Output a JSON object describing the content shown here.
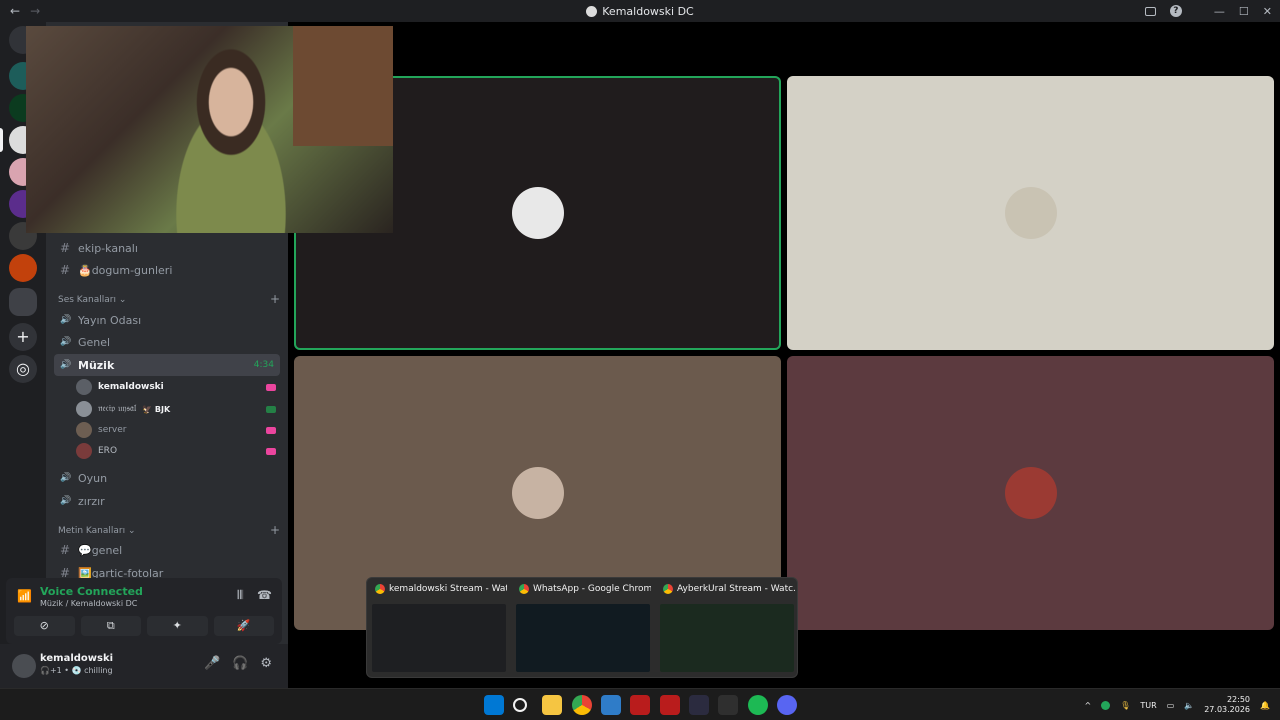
{
  "window": {
    "title": "Kemaldowski DC",
    "back_glyph": "←",
    "forward_glyph": "→"
  },
  "titlebar_icons": [
    "inbox-icon",
    "help-icon",
    "minimize-icon",
    "maximize-icon",
    "close-icon"
  ],
  "titlebar_glyphs": {
    "help": "?",
    "minimize": "—",
    "maximize": "☐",
    "close": "✕"
  },
  "sidebar": {
    "text_channels_top": [
      {
        "name": "ekip-kanalı",
        "symbol": "#"
      },
      {
        "name": "🎂dogum-gunleri",
        "symbol": "#"
      }
    ],
    "voice_category": {
      "label": "Ses Kanalları ⌄",
      "add": "+"
    },
    "voice_channels": [
      {
        "name": "Yayın Odası",
        "symbol": "🔊"
      },
      {
        "name": "Genel",
        "symbol": "🔊"
      },
      {
        "name": "Müzik",
        "symbol": "🔊",
        "time": "4:34",
        "active": true
      }
    ],
    "voice_users": [
      {
        "name": "kemaldowski",
        "avatar_color": "#5b5f66",
        "status_color": "#eb459e"
      },
      {
        "name": "𝔫𝔢𝔠𝔦𝔭 𝔲𝔶𝔰𝔞𝔩",
        "badge": "🦅 BJK",
        "avatar_color": "#8a8f96",
        "status_color": "#248046"
      },
      {
        "name": "server",
        "avatar_color": "#6d5e52",
        "status_color": "#eb459e"
      },
      {
        "name": "ERO",
        "avatar_color": "#7a3b3b",
        "status_color": "#eb459e"
      }
    ],
    "voice_channels_after": [
      {
        "name": "Oyun",
        "symbol": "🔊"
      },
      {
        "name": "zırzır",
        "symbol": "🔊"
      }
    ],
    "text_category": {
      "label": "Metin Kanalları ⌄",
      "add": "+"
    },
    "text_channels_bottom": [
      {
        "name": "💬genel",
        "symbol": "#"
      },
      {
        "name": "🖼️gartic-fotolar",
        "symbol": "#"
      }
    ]
  },
  "voice_panel": {
    "title": "Voice Connected",
    "subtitle": "Müzik / Kemaldowski DC",
    "signal_glyph": "📶",
    "right_glyphs": [
      "𝄃𝄃",
      "☎"
    ],
    "buttons": [
      "⊘",
      "⧉",
      "✦",
      "🚀"
    ]
  },
  "user": {
    "name": "kemaldowski",
    "status": "🎧+1 • 💿 chilling",
    "controls": [
      "🎤",
      "🎧",
      "⚙"
    ]
  },
  "stage": {
    "tiles": [
      {
        "bg": "#201c1d",
        "avatar": "#e8e8e8",
        "speaking": true
      },
      {
        "bg": "#d4d1c6",
        "avatar": "#c9c3b3",
        "speaking": false
      },
      {
        "bg": "#6b5a4d",
        "avatar": "#c7b3a3",
        "speaking": false
      },
      {
        "bg": "#5c3a3f",
        "avatar": "#9b3a33",
        "speaking": false
      }
    ]
  },
  "thumbnails": [
    {
      "title": "kemaldowski Stream - Wat..."
    },
    {
      "title": "WhatsApp - Google Chrome"
    },
    {
      "title": "AyberkUral Stream - Watc..."
    }
  ],
  "taskbar": {
    "apps": [
      "windows-start-icon",
      "search-icon",
      "file-explorer-icon",
      "chrome-icon",
      "photos-icon",
      "twitch-icon",
      "twitch-icon-2",
      "kick-icon",
      "terminal-icon",
      "spotify-icon",
      "discord-icon"
    ],
    "tray": {
      "chevron": "^",
      "lang": "TUR",
      "time": "22:50",
      "date": "27.03.2026"
    }
  }
}
